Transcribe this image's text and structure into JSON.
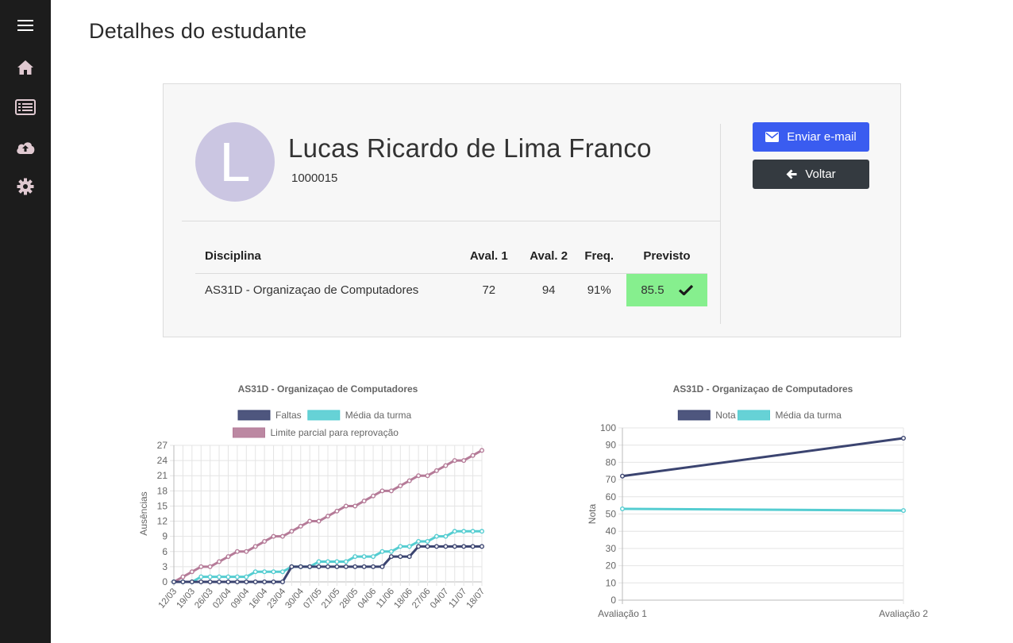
{
  "sidebar": {
    "items": [
      {
        "icon": "menu-icon"
      },
      {
        "icon": "home-icon"
      },
      {
        "icon": "list-icon"
      },
      {
        "icon": "cloud-upload-icon"
      },
      {
        "icon": "gear-icon"
      }
    ]
  },
  "page": {
    "title": "Detalhes do estudante"
  },
  "student": {
    "initial": "L",
    "name": "Lucas Ricardo de Lima Franco",
    "id": "1000015"
  },
  "actions": {
    "email_label": "Enviar e-mail",
    "back_label": "Voltar"
  },
  "grades_table": {
    "headers": [
      "Disciplina",
      "Aval. 1",
      "Aval. 2",
      "Freq.",
      "Previsto"
    ],
    "rows": [
      {
        "discipline": "AS31D - Organizaçao de Computadores",
        "aval1": "72",
        "aval2": "94",
        "freq": "91%",
        "predicted": "85.5"
      }
    ]
  },
  "colors": {
    "faltas": "#3b4470",
    "media": "#55cdd1",
    "limite": "#b57b98",
    "predicted_bg": "#86ef8e"
  },
  "chart_data": [
    {
      "type": "line",
      "title": "AS31D - Organizaçao de Computadores",
      "ylabel": "Ausências",
      "xlabel": "",
      "ylim": [
        0,
        27
      ],
      "yticks": [
        0,
        3,
        6,
        9,
        12,
        15,
        18,
        21,
        24,
        27
      ],
      "x_tick_labels": [
        "12/03",
        "19/03",
        "26/03",
        "02/04",
        "09/04",
        "16/04",
        "23/04",
        "30/04",
        "07/05",
        "21/05",
        "28/05",
        "04/06",
        "11/06",
        "18/06",
        "27/06",
        "04/07",
        "11/07",
        "18/07"
      ],
      "grid": true,
      "legend_position": "top",
      "series": [
        {
          "name": "Faltas",
          "values": [
            0,
            0,
            0,
            0,
            0,
            0,
            0,
            0,
            0,
            0,
            0,
            0,
            0,
            3,
            3,
            3,
            3,
            3,
            3,
            3,
            3,
            3,
            3,
            3,
            5,
            5,
            5,
            7,
            7,
            7,
            7,
            7,
            7,
            7,
            7
          ]
        },
        {
          "name": "Média da turma",
          "values": [
            0,
            0,
            0,
            1,
            1,
            1,
            1,
            1,
            1,
            2,
            2,
            2,
            2,
            3,
            3,
            3,
            4,
            4,
            4,
            4,
            5,
            5,
            5,
            6,
            6,
            7,
            7,
            8,
            8,
            9,
            9,
            10,
            10,
            10,
            10
          ]
        },
        {
          "name": "Limite parcial para reprovação",
          "values": [
            0,
            1,
            2,
            3,
            3,
            4,
            5,
            6,
            6,
            7,
            8,
            9,
            9,
            10,
            11,
            12,
            12,
            13,
            14,
            15,
            15,
            16,
            17,
            18,
            18,
            19,
            20,
            21,
            21,
            22,
            23,
            24,
            24,
            25,
            26
          ]
        }
      ]
    },
    {
      "type": "line",
      "title": "AS31D - Organizaçao de Computadores",
      "ylabel": "Nota",
      "xlabel": "",
      "ylim": [
        0,
        100
      ],
      "yticks": [
        0,
        10,
        20,
        30,
        40,
        50,
        60,
        70,
        80,
        90,
        100
      ],
      "categories": [
        "Avaliação 1",
        "Avaliação 2"
      ],
      "grid": true,
      "legend_position": "top",
      "series": [
        {
          "name": "Nota",
          "values": [
            72,
            94
          ]
        },
        {
          "name": "Média da turma",
          "values": [
            53,
            52
          ]
        }
      ]
    }
  ]
}
